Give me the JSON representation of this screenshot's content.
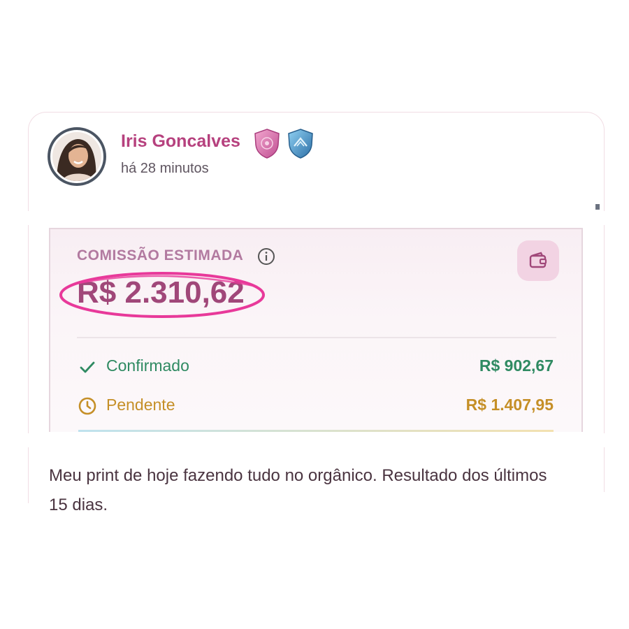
{
  "post": {
    "author": "Iris Goncalves",
    "time_ago": "há 28 minutos",
    "badges": [
      "pink-shield-icon",
      "blue-shield-icon"
    ],
    "caption": "Meu print de hoje fazendo tudo no orgânico. Resultado dos últimos 15 dias."
  },
  "commission": {
    "label": "COMISSÃO ESTIMADA",
    "total": "R$ 2.310,62",
    "rows": [
      {
        "label": "Confirmado",
        "value": "R$ 902,67",
        "status": "confirmed",
        "icon": "check-icon"
      },
      {
        "label": "Pendente",
        "value": "R$ 1.407,95",
        "status": "pending",
        "icon": "clock-icon"
      }
    ]
  },
  "colors": {
    "accent": "#b6417e",
    "highlight": "#e8399a",
    "confirmed": "#2f8a62",
    "pending": "#c58f27"
  }
}
